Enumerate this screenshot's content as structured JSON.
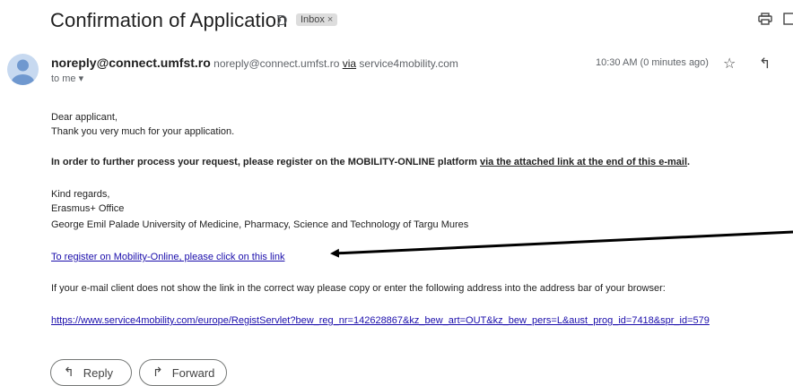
{
  "subject": "Confirmation of Application",
  "inbox_label": "Inbox",
  "inbox_label_close": "×",
  "sender": {
    "name": "noreply@connect.umfst.ro",
    "email": "noreply@connect.umfst.ro",
    "via_label": "via",
    "via_domain": "service4mobility.com",
    "to_label": "to me"
  },
  "time": "10:30 AM (0 minutes ago)",
  "body": {
    "greeting": "Dear applicant,",
    "thanks": "Thank you very much for your application.",
    "instruction_main": "In order to further process your request, please register on the MOBILITY-ONLINE platform ",
    "instruction_link": "via the attached link at the end of this e-mail",
    "instruction_end": ".",
    "regards": "Kind regards,",
    "office": "Erasmus+ Office",
    "university": "George Emil Palade University of Medicine, Pharmacy, Science and Technology of Targu Mures",
    "register_link": "To register on Mobility-Online, please click on this link",
    "fallback_text": "If your e-mail client does not show the link in the correct way please copy or enter the following address into the address bar of your browser:",
    "url": "https://www.service4mobility.com/europe/RegistServlet?bew_reg_nr=142628867&kz_bew_art=OUT&kz_bew_pers=L&aust_prog_id=7418&spr_id=579"
  },
  "actions": {
    "reply": "Reply",
    "forward": "Forward"
  },
  "icons": [
    "importance-icon",
    "print-icon",
    "new-window-icon",
    "star-icon",
    "reply-icon",
    "more-icon",
    "arrow-annotation"
  ],
  "colors": {
    "link": "#1a0dab",
    "label_bg": "#dddddd",
    "avatar_bg": "#c7d9f0",
    "avatar_fg": "#6f98cf"
  }
}
